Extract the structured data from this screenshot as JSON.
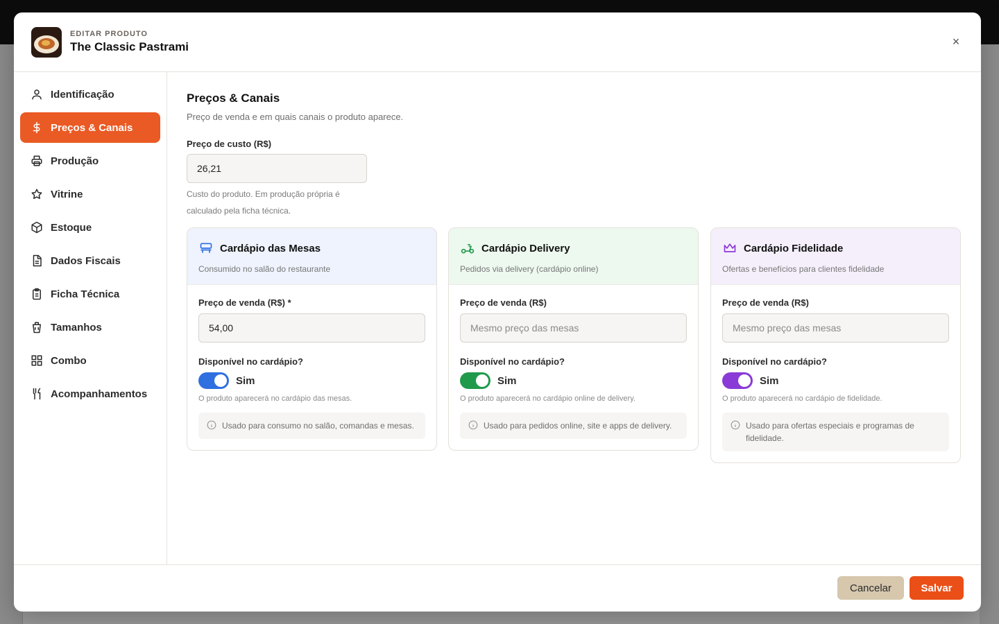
{
  "header": {
    "kicker": "EDITAR PRODUTO",
    "title": "The Classic Pastrami",
    "close_label": "×"
  },
  "sidebar": {
    "items": [
      {
        "label": "Identificação",
        "icon": "user-icon"
      },
      {
        "label": "Preços & Canais",
        "icon": "dollar-icon",
        "active": true
      },
      {
        "label": "Produção",
        "icon": "printer-icon"
      },
      {
        "label": "Vitrine",
        "icon": "star-icon"
      },
      {
        "label": "Estoque",
        "icon": "box-icon"
      },
      {
        "label": "Dados Fiscais",
        "icon": "document-icon"
      },
      {
        "label": "Ficha Técnica",
        "icon": "clipboard-icon"
      },
      {
        "label": "Tamanhos",
        "icon": "cup-icon"
      },
      {
        "label": "Combo",
        "icon": "grid-icon"
      },
      {
        "label": "Acompanhamentos",
        "icon": "utensils-icon"
      }
    ]
  },
  "main": {
    "title": "Preços & Canais",
    "subtitle": "Preço de venda e em quais canais o produto aparece.",
    "cost": {
      "label": "Preço de custo (R$)",
      "value": "26,21",
      "help": "Custo do produto. Em produção própria é calculado pela ficha técnica."
    },
    "channels": [
      {
        "title": "Cardápio das Mesas",
        "subtitle": "Consumido no salão do restaurante",
        "price_label": "Preço de venda (R$) *",
        "price_value": "54,00",
        "price_placeholder": "",
        "available_label": "Disponível no cardápio?",
        "toggle_text": "Sim",
        "toggle_on": true,
        "toggle_help": "O produto aparecerá no cardápio das mesas.",
        "info": "Usado para consumo no salão, comandas e mesas.",
        "head_color": "#eef3fd",
        "accent_color": "#2f6fe0",
        "icon": "table-icon"
      },
      {
        "title": "Cardápio Delivery",
        "subtitle": "Pedidos via delivery (cardápio online)",
        "price_label": "Preço de venda (R$)",
        "price_value": "",
        "price_placeholder": "Mesmo preço das mesas",
        "available_label": "Disponível no cardápio?",
        "toggle_text": "Sim",
        "toggle_on": true,
        "toggle_help": "O produto aparecerá no cardápio online de delivery.",
        "info": "Usado para pedidos online, site e apps de delivery.",
        "head_color": "#edf8ef",
        "accent_color": "#1f9a4b",
        "icon": "scooter-icon"
      },
      {
        "title": "Cardápio Fidelidade",
        "subtitle": "Ofertas e benefícios para clientes fidelidade",
        "price_label": "Preço de venda (R$)",
        "price_value": "",
        "price_placeholder": "Mesmo preço das mesas",
        "available_label": "Disponível no cardápio?",
        "toggle_text": "Sim",
        "toggle_on": true,
        "toggle_help": "O produto aparecerá no cardápio de fidelidade.",
        "info": "Usado para ofertas especiais e programas de fidelidade.",
        "head_color": "#f5effb",
        "accent_color": "#8a3ad6",
        "icon": "crown-icon"
      }
    ]
  },
  "footer": {
    "cancel_label": "Cancelar",
    "save_label": "Salvar"
  },
  "colors": {
    "brand": "#ea5a24",
    "save": "#ea4f18",
    "cancel": "#d6c7ad"
  }
}
